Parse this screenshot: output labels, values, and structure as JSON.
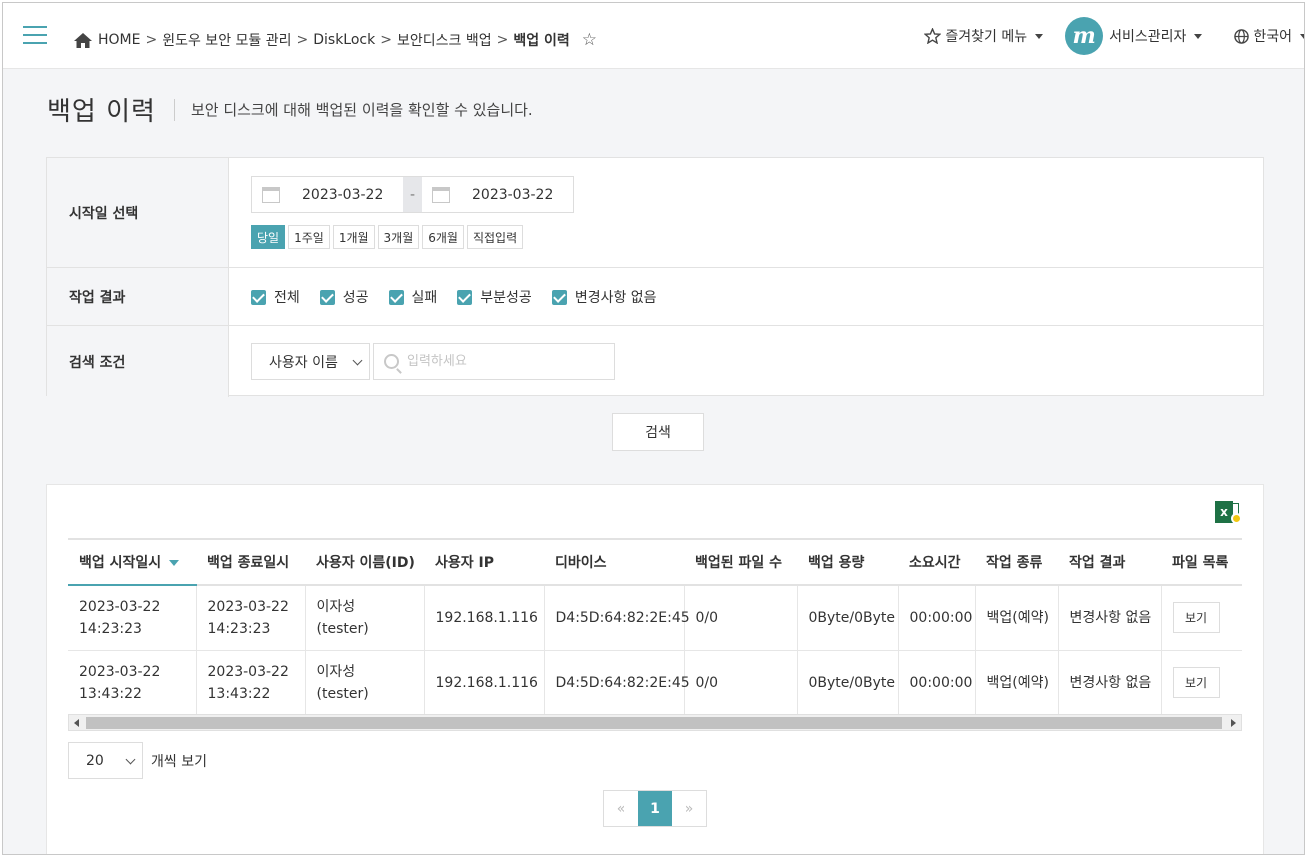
{
  "header": {
    "breadcrumb": [
      "HOME",
      "윈도우 보안 모듈 관리",
      "DiskLock",
      "보안디스크 백업",
      "백업 이력"
    ],
    "favorites_label": "즐겨찾기 메뉴",
    "user_initial": "m",
    "user_label": "서비스관리자",
    "language_label": "한국어"
  },
  "page": {
    "title": "백업 이력",
    "description": "보안 디스크에 대해 백업된 이력을 확인할 수 있습니다."
  },
  "search": {
    "date_label": "시작일 선택",
    "start_date": "2023-03-22",
    "end_date": "2023-03-22",
    "range_sep": "-",
    "quick_ranges": [
      "당일",
      "1주일",
      "1개월",
      "3개월",
      "6개월",
      "직접입력"
    ],
    "quick_selected": "당일",
    "result_label": "작업 결과",
    "result_options": [
      "전체",
      "성공",
      "실패",
      "부분성공",
      "변경사항 없음"
    ],
    "condition_label": "검색 조건",
    "condition_select": "사용자 이름",
    "condition_placeholder": "입력하세요",
    "search_button": "검색"
  },
  "table": {
    "columns": [
      "백업 시작일시",
      "백업 종료일시",
      "사용자 이름(ID)",
      "사용자 IP",
      "디바이스",
      "백업된 파일 수",
      "백업 용량",
      "소요시간",
      "작업 종류",
      "작업 결과",
      "파일 목록"
    ],
    "sorted_column": "백업 시작일시",
    "rows": [
      {
        "start_date": "2023-03-22",
        "start_time": "14:23:23",
        "end_date": "2023-03-22",
        "end_time": "14:23:23",
        "user_name": "이자성",
        "user_id": "(tester)",
        "ip": "192.168.1.116",
        "device": "D4:5D:64:82:2E:45",
        "files": "0/0",
        "size": "0Byte/0Byte",
        "duration": "00:00:00",
        "job_type": "백업(예약)",
        "result": "변경사항 없음",
        "view_label": "보기"
      },
      {
        "start_date": "2023-03-22",
        "start_time": "13:43:22",
        "end_date": "2023-03-22",
        "end_time": "13:43:22",
        "user_name": "이자성",
        "user_id": "(tester)",
        "ip": "192.168.1.116",
        "device": "D4:5D:64:82:2E:45",
        "files": "0/0",
        "size": "0Byte/0Byte",
        "duration": "00:00:00",
        "job_type": "백업(예약)",
        "result": "변경사항 없음",
        "view_label": "보기"
      }
    ]
  },
  "pagination": {
    "page_size": "20",
    "per_page_label": "개씩 보기",
    "prev": "«",
    "current_page": "1",
    "next": "»"
  },
  "colors": {
    "accent": "#4aa3b0",
    "excel_green": "#1e7145"
  },
  "icons": [
    "menu-icon",
    "home-icon",
    "star-icon",
    "globe-icon",
    "calendar-icon",
    "search-icon",
    "excel-download-icon",
    "sort-desc-icon"
  ]
}
